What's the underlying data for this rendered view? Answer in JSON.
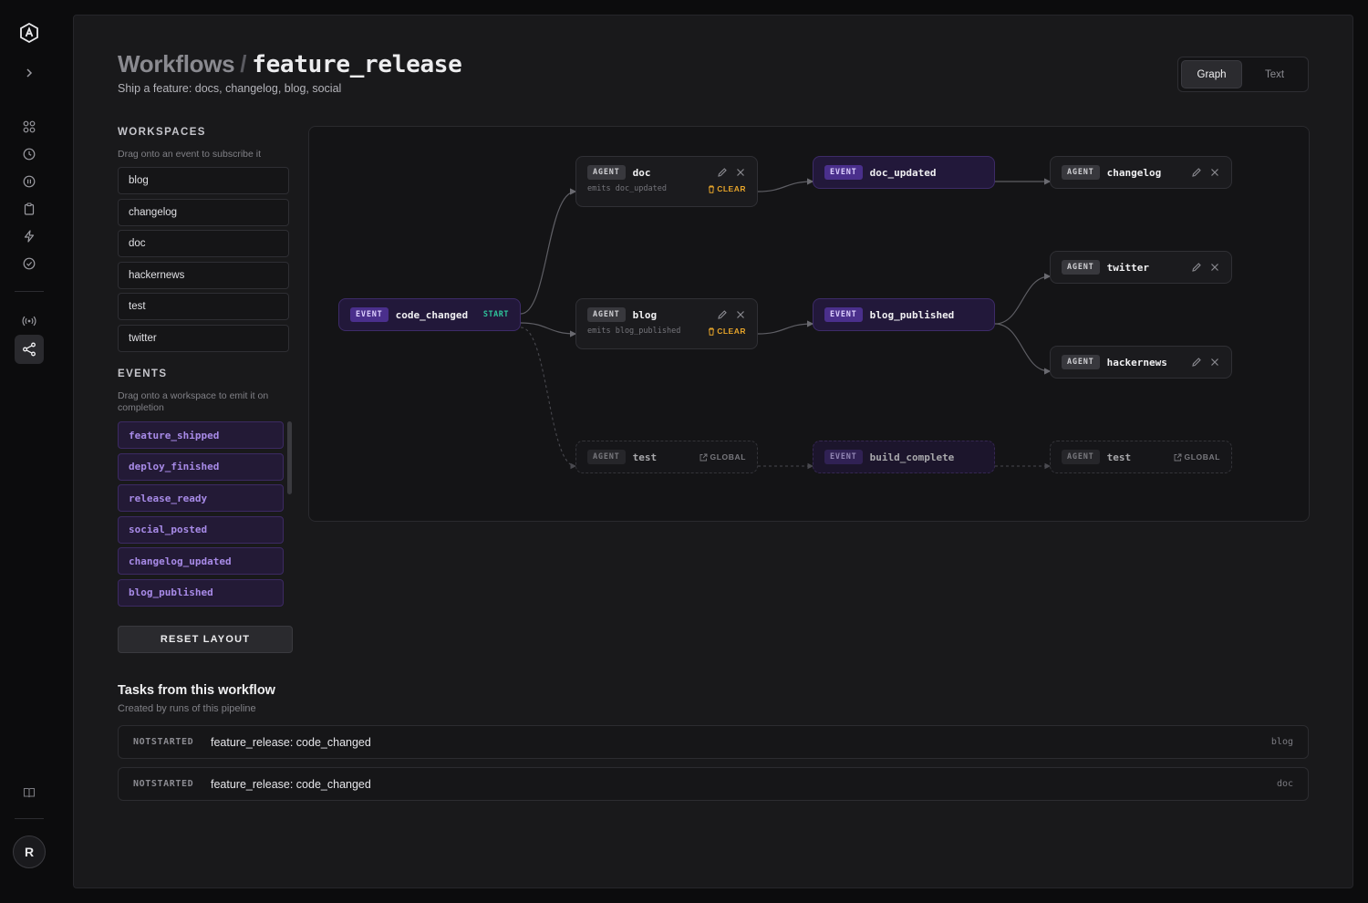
{
  "header": {
    "breadcrumb_root": "Workflows",
    "breadcrumb_sep": "/",
    "workflow_name": "feature_release",
    "subtitle": "Ship a feature: docs, changelog, blog, social"
  },
  "view_toggle": {
    "graph": "Graph",
    "text": "Text",
    "selected": "Graph"
  },
  "workspaces": {
    "heading": "WORKSPACES",
    "note": "Drag onto an event to subscribe it",
    "items": [
      "blog",
      "changelog",
      "doc",
      "hackernews",
      "test",
      "twitter"
    ]
  },
  "events": {
    "heading": "EVENTS",
    "note": "Drag onto a workspace to emit it on completion",
    "items": [
      "feature_shipped",
      "deploy_finished",
      "release_ready",
      "social_posted",
      "changelog_updated",
      "blog_published"
    ]
  },
  "reset_label": "RESET LAYOUT",
  "graph": {
    "labels": {
      "agent": "AGENT",
      "event": "EVENT",
      "start": "START",
      "clear": "CLEAR",
      "global": "GLOBAL"
    },
    "nodes": {
      "code_changed": "code_changed",
      "doc": "doc",
      "doc_emits": "emits doc_updated",
      "blog": "blog",
      "blog_emits": "emits blog_published",
      "test1": "test",
      "doc_updated": "doc_updated",
      "blog_published": "blog_published",
      "build_complete": "build_complete",
      "changelog": "changelog",
      "twitter": "twitter",
      "hackernews": "hackernews",
      "test2": "test"
    }
  },
  "tasks": {
    "title": "Tasks from this workflow",
    "subtitle": "Created by runs of this pipeline",
    "rows": [
      {
        "status": "NOTSTARTED",
        "title": "feature_release: code_changed",
        "workspace": "blog"
      },
      {
        "status": "NOTSTARTED",
        "title": "feature_release: code_changed",
        "workspace": "doc"
      }
    ]
  },
  "avatar_initial": "R",
  "colors": {
    "accent_purple": "#a88be8",
    "start_green": "#2ec39a",
    "clear_amber": "#e6a42a"
  }
}
